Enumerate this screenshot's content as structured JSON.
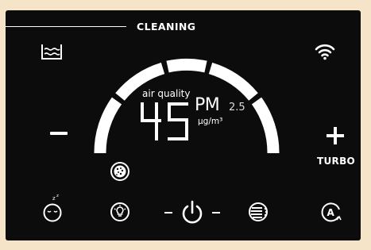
{
  "status": {
    "mode_label": "CLEANING"
  },
  "display": {
    "air_quality_label": "air quality",
    "value": "45",
    "unit_main": "PM",
    "unit_sub": "2.5",
    "unit_concentration": "μg/m³",
    "arc_segments_lit": 5,
    "arc_segments_total": 5
  },
  "controls": {
    "turbo_label": "TURBO",
    "icons": [
      "water-tank-icon",
      "wifi-icon",
      "minus-icon",
      "plus-icon",
      "filter-status-icon",
      "sleep-mode-icon",
      "light-bulb-icon",
      "power-icon",
      "fan-speed-icon",
      "auto-mode-icon"
    ]
  },
  "colors": {
    "background": "#0c0c0c",
    "foreground": "#ffffff",
    "surround": "#f5e4c8"
  }
}
